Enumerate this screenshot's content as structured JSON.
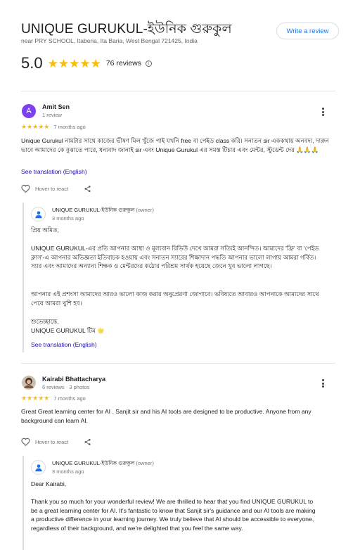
{
  "business": {
    "title": "UNIQUE GURUKUL-ইউনিক গুরুকুল",
    "address": "near PRY SCHOOL, Itaberia, Ita Baria, West Bengal 721425, India",
    "write_review_label": "Write a review",
    "rating": "5.0",
    "stars": "★★★★★",
    "reviews_count": "76 reviews",
    "info_icon": "ⓘ"
  },
  "colors": {
    "star": "#fbbc04",
    "link": "#1a0dab",
    "accent_blue": "#1a73e8",
    "avatar_purple": "#7e3ff2"
  },
  "reviews": [
    {
      "name": "Amit Sen",
      "avatar_letter": "A",
      "meta": "1 review",
      "stars": "★★★★★",
      "time": "7 months ago",
      "text": "Unique Gurukul নামটার সাথে কাজের ভীষণ মিল খুঁজে পাই যখনি free বা পেইড class করি। সনাতন sir এককথায় অনবদ্য, দারুন ভাবে আমাদের কে বুঝাতে পারে, ধন্যবাদ জানাই sir এবং Unique Gurukul এর সমস্ত টিচার এবং মেন্টর, স্টুডেন্ট দের 🙏🙏🙏",
      "translate": "See translation (English)",
      "hover_text": "Hover to react",
      "owner": {
        "name": "UNIQUE GURUKUL-ইউনিক গুরুকুল",
        "tag": "(owner)",
        "time": "3 months ago",
        "paragraphs": [
          "প্রিয় অমিত,",
          "UNIQUE GURUKUL-এর প্রতি আপনার আস্থা ও মূল্যবান রিভিউ দেখে আমরা সত্যিই আনন্দিত। আমাদের 'ফ্রি' বা 'পেইড ক্লাস'-এ আপনার অভিজ্ঞতা ইতিবাচক হওয়ায় এবং সনাতন স্যারের শিক্ষাদান পদ্ধতি আপনার ভালো লাগায় আমরা গর্বিত। স্যার এবং আমাদের অন্যান্য শিক্ষক ও মেন্টরদের কঠোর পরিশ্রম সার্থক হয়েছে জেনে খুব ভালো লাগছে।",
          "আপনার এই প্রশংসা আমাদের আরও ভালো কাজ করার অনুপ্রেরণা জোগাবে। ভবিষ্যতে আবারও আপনাকে আমাদের সাথে পেয়ে আমরা খুশি হব।",
          "শুভেচ্ছান্তে,",
          "UNIQUE GURUKUL টিম 🌟"
        ],
        "translate": "See translation (English)"
      }
    },
    {
      "name": "Kairabi Bhattacharya",
      "meta": "6 reviews · 3 photos",
      "stars": "★★★★★",
      "time": "7 months ago",
      "text": "Great Great learning center for AI . Sanjit sir and his AI tools are designed to be productive. Anyone from any background can learn AI.",
      "hover_text": "Hover to react",
      "owner": {
        "name": "UNIQUE GURUKUL-ইউনিক গুরুকুল",
        "tag": "(owner)",
        "time": "3 months ago",
        "paragraphs": [
          "Dear Kairabi,",
          "Thank you so much for your wonderful review! We are thrilled to hear that you find UNIQUE GURUKUL to be a great learning center for AI. It's fantastic to know that Sanjit sir's guidance and our AI tools are making a productive difference in your learning journey. We truly believe that AI should be accessible to everyone, regardless of their background, and we're delighted that you feel the same way."
        ]
      }
    }
  ]
}
